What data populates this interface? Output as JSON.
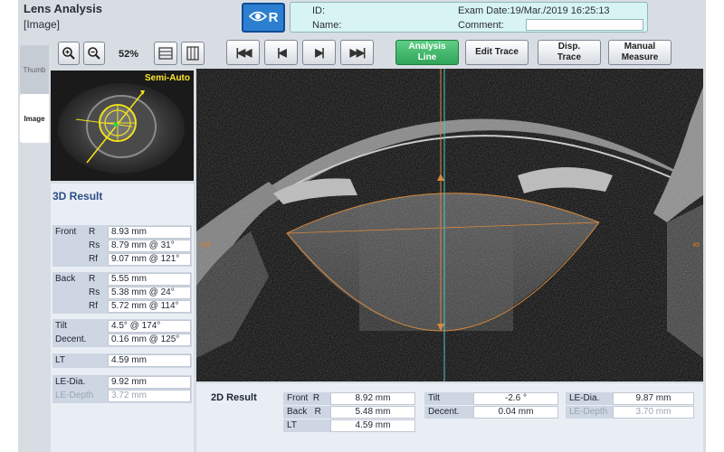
{
  "header": {
    "title": "Lens Analysis",
    "subtitle": "[Image]",
    "eye": "R",
    "id_label": "ID:",
    "name_label": "Name:",
    "exam_date_label": "Exam Date:",
    "exam_date": "19/Mar./2019 16:25:13",
    "comment_label": "Comment:"
  },
  "toolbar": {
    "zoom_level": "52%",
    "mode_buttons": {
      "analysis_line": "Analysis\nLine",
      "edit_trace": "Edit Trace",
      "disp_trace": "Disp.\nTrace",
      "manual_measure": "Manual\nMeasure"
    }
  },
  "side_tabs": {
    "thumb": "Thumb",
    "image": "Image"
  },
  "thumbnail": {
    "label": "Semi-Auto"
  },
  "result_3d": {
    "title": "3D Result",
    "front_label": "Front",
    "back_label": "Back",
    "rows": {
      "front_r": {
        "sub": "R",
        "value": "8.93 mm"
      },
      "front_rs": {
        "sub": "Rs",
        "value": "8.79 mm  @ 31°"
      },
      "front_rf": {
        "sub": "Rf",
        "value": "9.07 mm  @ 121°"
      },
      "back_r": {
        "sub": "R",
        "value": "5.55 mm"
      },
      "back_rs": {
        "sub": "Rs",
        "value": "5.38 mm  @ 24°"
      },
      "back_rf": {
        "sub": "Rf",
        "value": "5.72 mm  @ 114°"
      },
      "tilt": {
        "label": "Tilt",
        "value": "4.5°  @ 174°"
      },
      "decent": {
        "label": "Decent.",
        "value": "0.16 mm  @ 125°"
      },
      "lt": {
        "label": "LT",
        "value": "4.59 mm"
      },
      "le_dia": {
        "label": "LE-Dia.",
        "value": "9.92 mm"
      },
      "le_depth": {
        "label": "LE-Depth",
        "value": "3.72 mm"
      }
    }
  },
  "image": {
    "left_marker": "225",
    "right_marker": "45"
  },
  "result_2d": {
    "title": "2D Result",
    "front_r": {
      "label": "Front",
      "sub": "R",
      "value": "8.92 mm"
    },
    "back_r": {
      "label": "Back",
      "sub": "R",
      "value": "5.48 mm"
    },
    "lt": {
      "label": "LT",
      "value": "4.59 mm"
    },
    "tilt": {
      "label": "Tilt",
      "value": "-2.6 °"
    },
    "decent": {
      "label": "Decent.",
      "value": "0.04 mm"
    },
    "le_dia": {
      "label": "LE-Dia.",
      "value": "9.87 mm"
    },
    "le_depth": {
      "label": "LE-Depth",
      "value": "3.70 mm"
    }
  },
  "colors": {
    "accent_green": "#2fa45a",
    "eye_blue": "#2c7fd0",
    "trace_orange": "#e07b1a",
    "semi_auto_yellow": "#ffe92a"
  }
}
